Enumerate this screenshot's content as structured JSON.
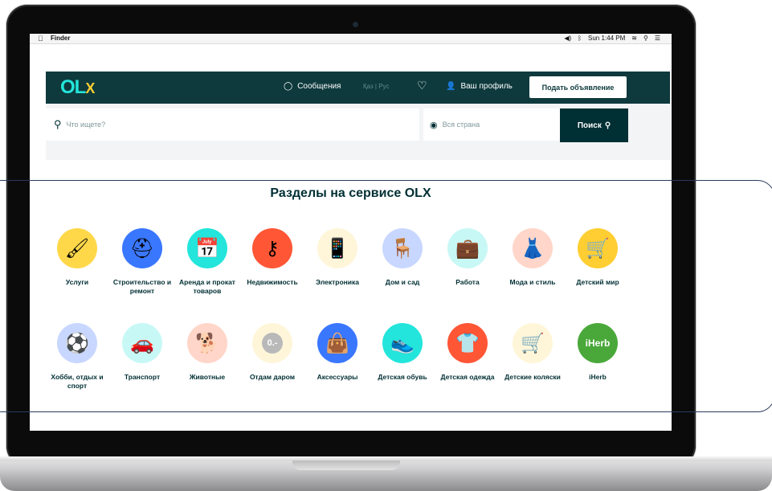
{
  "menubar": {
    "app": "Finder",
    "right_text": "Sun 1:44 PM"
  },
  "header": {
    "logo_main": "OL",
    "logo_x": "X",
    "messages": "Сообщения",
    "lang": "Қаз | Рус",
    "profile": "Ваш профиль",
    "post_button": "Подать объявление"
  },
  "search": {
    "placeholder": "Что ищете?",
    "location_placeholder": "Вся страна",
    "button": "Поиск"
  },
  "sections": {
    "title": "Разделы на сервисе OLX",
    "row1": [
      {
        "label": "Услуги",
        "icon": "paint-roller-icon",
        "bg": "#ffd84a",
        "glyph": "🖌"
      },
      {
        "label": "Строительство и ремонт",
        "icon": "hard-hat-icon",
        "bg": "#3a77ff",
        "glyph": "⛑"
      },
      {
        "label": "Аренда и прокат товаров",
        "icon": "calendar-icon",
        "bg": "#23e5db",
        "glyph": "📅"
      },
      {
        "label": "Недвижимость",
        "icon": "key-icon",
        "bg": "#ff5636",
        "glyph": "⚷"
      },
      {
        "label": "Электроника",
        "icon": "phone-icon",
        "bg": "#fff6d9",
        "glyph": "📱"
      },
      {
        "label": "Дом и сад",
        "icon": "chair-icon",
        "bg": "#c8d7ff",
        "glyph": "🪑"
      },
      {
        "label": "Работа",
        "icon": "briefcase-icon",
        "bg": "#c8f8f6",
        "glyph": "💼"
      },
      {
        "label": "Мода и стиль",
        "icon": "dress-icon",
        "bg": "#ffd6c9",
        "glyph": "👗"
      },
      {
        "label": "Детский мир",
        "icon": "stroller-icon",
        "bg": "#ffce32",
        "glyph": "🛒"
      }
    ],
    "row2": [
      {
        "label": "Хобби, отдых и спорт",
        "icon": "soccer-ball-icon",
        "bg": "#c8d7ff",
        "glyph": "⚽"
      },
      {
        "label": "Транспорт",
        "icon": "car-icon",
        "bg": "#c8f8f6",
        "glyph": "🚗"
      },
      {
        "label": "Животные",
        "icon": "dog-icon",
        "bg": "#ffd6c9",
        "glyph": "🐕"
      },
      {
        "label": "Отдам даром",
        "icon": "free-icon",
        "bg": "#fff6d9",
        "glyph": "0.-"
      },
      {
        "label": "Аксессуары",
        "icon": "bag-icon",
        "bg": "#3a77ff",
        "glyph": "👜"
      },
      {
        "label": "Детская обувь",
        "icon": "shoes-icon",
        "bg": "#23e5db",
        "glyph": "👟"
      },
      {
        "label": "Детская одежда",
        "icon": "bodysuit-icon",
        "bg": "#ff5636",
        "glyph": "👕"
      },
      {
        "label": "Детские коляски",
        "icon": "pram-icon",
        "bg": "#fff6d9",
        "glyph": "🛒"
      },
      {
        "label": "iHerb",
        "icon": "iherb-logo-icon",
        "bg": "#4aa83a",
        "glyph": "iHerb"
      }
    ]
  }
}
